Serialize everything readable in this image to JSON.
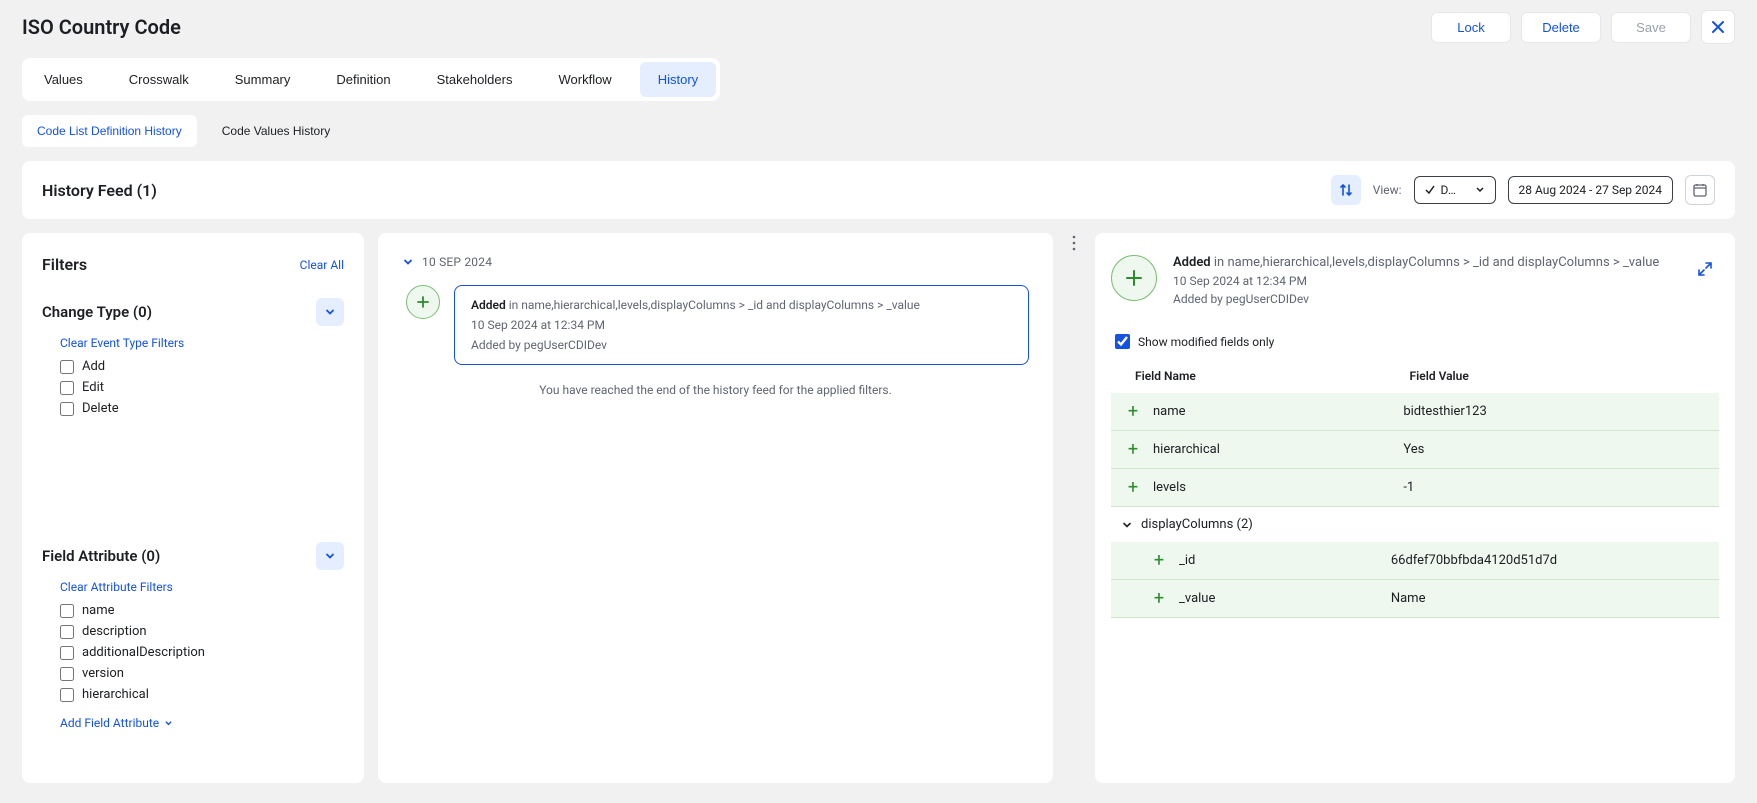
{
  "page": {
    "title": "ISO Country Code"
  },
  "header_buttons": {
    "lock": "Lock",
    "delete": "Delete",
    "save": "Save"
  },
  "tabs": {
    "values": "Values",
    "crosswalk": "Crosswalk",
    "summary": "Summary",
    "definition": "Definition",
    "stakeholders": "Stakeholders",
    "workflow": "Workflow",
    "history": "History"
  },
  "subtabs": {
    "code_list_def": "Code List Definition History",
    "code_values": "Code Values History"
  },
  "feed_header": {
    "title": "History Feed (1)",
    "view_label": "View:",
    "view_value": "D…",
    "date_range": "28 Aug 2024 - 27 Sep 2024"
  },
  "filters": {
    "title": "Filters",
    "clear_all": "Clear All",
    "change_type_title": "Change Type (0)",
    "clear_event": "Clear Event Type Filters",
    "change_type_items": {
      "add": "Add",
      "edit": "Edit",
      "delete": "Delete"
    },
    "field_attr_title": "Field Attribute (0)",
    "clear_attr": "Clear Attribute Filters",
    "field_attr_items": {
      "name": "name",
      "description": "description",
      "additionalDescription": "additionalDescription",
      "version": "version",
      "hierarchical": "hierarchical"
    },
    "add_attr": "Add Field Attribute"
  },
  "feed": {
    "date_group": "10 SEP 2024",
    "entry": {
      "action": "Added",
      "desc": "in name,hierarchical,levels,displayColumns > _id and displayColumns > _value",
      "timestamp": "10 Sep 2024 at 12:34 PM",
      "byline": "Added by pegUserCDIDev"
    },
    "end_msg": "You have reached the end of the history feed for the applied filters."
  },
  "detail": {
    "action": "Added",
    "desc": "in name,hierarchical,levels,displayColumns > _id and displayColumns > _value",
    "timestamp": "10 Sep 2024 at 12:34 PM",
    "byline": "Added by pegUserCDIDev",
    "modified_only": "Show modified fields only",
    "col_name": "Field Name",
    "col_value": "Field Value",
    "rows": [
      {
        "name": "name",
        "value": "bidtesthier123"
      },
      {
        "name": "hierarchical",
        "value": "Yes"
      },
      {
        "name": "levels",
        "value": "-1"
      }
    ],
    "group": "displayColumns (2)",
    "subrows": [
      {
        "name": "_id",
        "value": "66dfef70bbfbda4120d51d7d"
      },
      {
        "name": "_value",
        "value": "Name"
      }
    ]
  }
}
